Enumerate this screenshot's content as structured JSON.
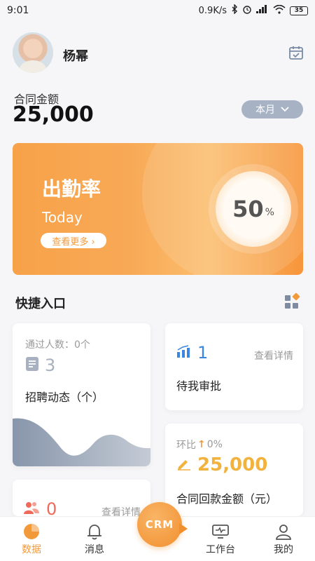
{
  "status_bar": {
    "time": "9:01",
    "network_speed": "0.9K/s",
    "battery": "35"
  },
  "header": {
    "user_name": "杨幂"
  },
  "contract": {
    "label": "合同金额",
    "value": "25,000",
    "period": "本月"
  },
  "attendance": {
    "title": "出勤率",
    "subtitle": "Today",
    "view_more": "查看更多 ›",
    "rate": "50",
    "rate_unit": "%"
  },
  "quick_entry": {
    "title": "快捷入口"
  },
  "cards": {
    "recruit": {
      "passed": "通过人数：0个",
      "count": "3",
      "label": "招聘动态（个）"
    },
    "approval": {
      "count": "1",
      "detail": "查看详情",
      "label": "待我审批"
    },
    "payment": {
      "compare_label": "环比",
      "compare_arrow": "↑",
      "compare_value": "0%",
      "value": "25,000",
      "label": "合同回款金额（元）"
    },
    "customer": {
      "count": "0",
      "detail": "查看详情"
    }
  },
  "bottom_nav": {
    "items": [
      {
        "label": "数据",
        "icon": "pie-chart-icon",
        "active": true
      },
      {
        "label": "消息",
        "icon": "bell-icon",
        "active": false
      },
      {
        "label": "工作台",
        "icon": "monitor-icon",
        "active": false
      },
      {
        "label": "我的",
        "icon": "person-icon",
        "active": false
      }
    ],
    "center_label": "CRM"
  },
  "colors": {
    "accent": "#F29A3A",
    "approval": "#3A86E0",
    "payment": "#F1B23E",
    "customer": "#EF6A5A"
  }
}
